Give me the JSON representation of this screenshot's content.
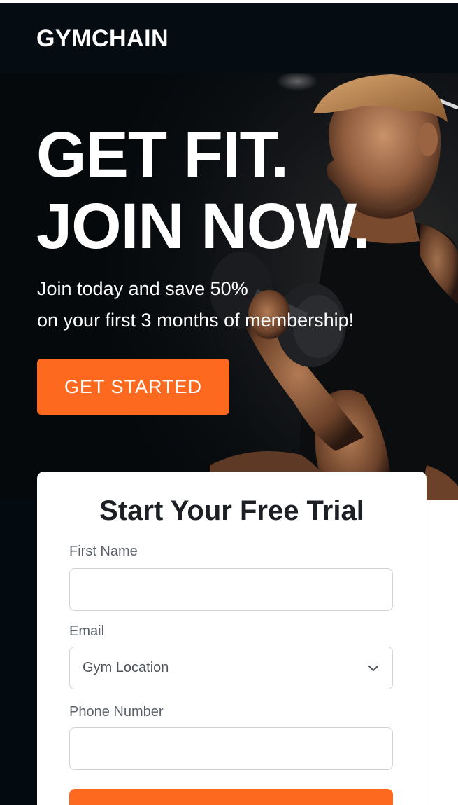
{
  "brand": {
    "name": "GYMCHAIN"
  },
  "hero": {
    "title_line1": "GET FIT.",
    "title_line2": "JOIN NOW.",
    "subtitle_line1": "Join today and save 50%",
    "subtitle_line2": "on your first 3 months of membership!",
    "cta_label": "GET STARTED",
    "image": "man-lifting-dumbbell-photo"
  },
  "form": {
    "title": "Start Your Free Trial",
    "fields": [
      {
        "label": "First Name",
        "value": "",
        "placeholder": ""
      },
      {
        "label": "Email",
        "selected": "Gym Location",
        "icon": "chevron-down-icon"
      },
      {
        "label": "Phone Number",
        "value": "",
        "placeholder": ""
      }
    ],
    "submit_label": ""
  },
  "colors": {
    "accent": "#fd6a1f",
    "background": "#040b10",
    "card": "#ffffff",
    "text_dark": "#1c2024",
    "label_gray": "#5b6169"
  }
}
